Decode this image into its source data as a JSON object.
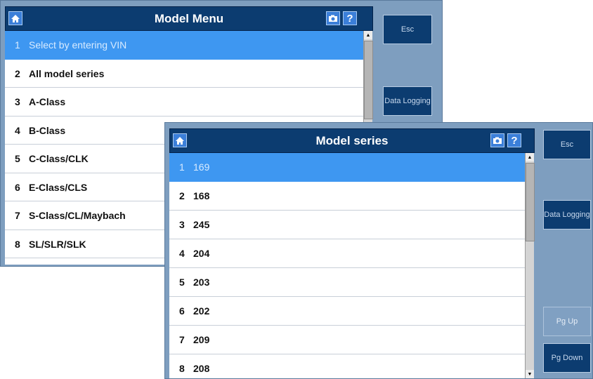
{
  "model_menu": {
    "title": "Model Menu",
    "help_label": "?",
    "items": [
      {
        "num": "1",
        "label": "Select by entering VIN"
      },
      {
        "num": "2",
        "label": "All model series"
      },
      {
        "num": "3",
        "label": "A-Class"
      },
      {
        "num": "4",
        "label": "B-Class"
      },
      {
        "num": "5",
        "label": "C-Class/CLK"
      },
      {
        "num": "6",
        "label": "E-Class/CLS"
      },
      {
        "num": "7",
        "label": "S-Class/CL/Maybach"
      },
      {
        "num": "8",
        "label": "SL/SLR/SLK"
      }
    ],
    "selected_index": 0,
    "side_buttons": {
      "esc": "Esc",
      "data_logging": "Data Logging"
    }
  },
  "model_series": {
    "title": "Model series",
    "help_label": "?",
    "items": [
      {
        "num": "1",
        "label": "169"
      },
      {
        "num": "2",
        "label": "168"
      },
      {
        "num": "3",
        "label": "245"
      },
      {
        "num": "4",
        "label": "204"
      },
      {
        "num": "5",
        "label": "203"
      },
      {
        "num": "6",
        "label": "202"
      },
      {
        "num": "7",
        "label": "209"
      },
      {
        "num": "8",
        "label": "208"
      }
    ],
    "selected_index": 0,
    "side_buttons": {
      "esc": "Esc",
      "data_logging": "Data Logging",
      "pg_up": "Pg Up",
      "pg_down": "Pg Down"
    }
  },
  "icons": {
    "home": "home-icon",
    "camera": "camera-icon",
    "help": "help-icon"
  },
  "colors": {
    "header": "#0c3c70",
    "panel": "#7e9ebf",
    "selected_row": "#3e97f1",
    "button": "#0c3c70",
    "button_disabled": "#80a0c2"
  }
}
